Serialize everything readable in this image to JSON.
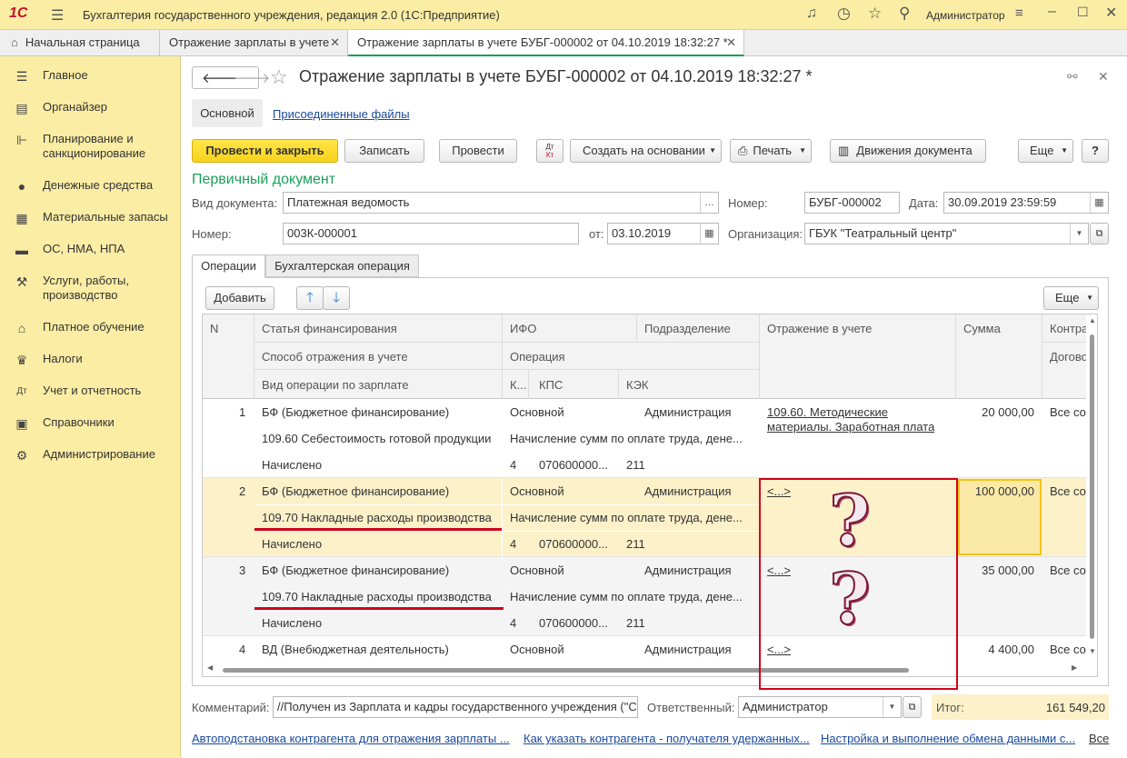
{
  "app": {
    "logo": "1С",
    "title": "Бухгалтерия государственного учреждения, редакция 2.0  (1С:Предприятие)",
    "user": "Администратор"
  },
  "tabs": [
    {
      "label": "Начальная страница"
    },
    {
      "label": "Отражение зарплаты в учете"
    },
    {
      "label": "Отражение зарплаты в учете БУБГ-000002 от 04.10.2019 18:32:27 *"
    }
  ],
  "sidebar": {
    "items": [
      {
        "label": "Главное",
        "icon": "menu-icon"
      },
      {
        "label": "Органайзер",
        "icon": "organizer-icon"
      },
      {
        "label": "Планирование и санкционирование",
        "icon": "planning-icon"
      },
      {
        "label": "Денежные средства",
        "icon": "money-icon"
      },
      {
        "label": "Материальные запасы",
        "icon": "materials-icon"
      },
      {
        "label": "ОС, НМА, НПА",
        "icon": "assets-icon"
      },
      {
        "label": "Услуги, работы, производство",
        "icon": "services-icon"
      },
      {
        "label": "Платное обучение",
        "icon": "education-icon"
      },
      {
        "label": "Налоги",
        "icon": "taxes-icon"
      },
      {
        "label": "Учет и отчетность",
        "icon": "reporting-icon"
      },
      {
        "label": "Справочники",
        "icon": "catalogs-icon"
      },
      {
        "label": "Администрирование",
        "icon": "gear-icon"
      }
    ]
  },
  "document": {
    "title": "Отражение зарплаты в учете БУБГ-000002 от 04.10.2019 18:32:27 *",
    "subtab_main": "Основной",
    "subtab_files": "Присоединенные файлы"
  },
  "toolbar": {
    "post_close": "Провести и закрыть",
    "save": "Записать",
    "post": "Провести",
    "dtkt_top": "Дт",
    "dtkt_bottom": "Кт",
    "create_based": "Создать на основании",
    "print": "Печать",
    "movements": "Движения документа",
    "more": "Еще",
    "help": "?"
  },
  "primary": {
    "section": "Первичный документ",
    "doc_type_label": "Вид документа:",
    "doc_type": "Платежная ведомость",
    "number_label": "Номер:",
    "number": "003К-000001",
    "from_label": "от:",
    "from": "03.10.2019",
    "number2_label": "Номер:",
    "number2": "БУБГ-000002",
    "date_label": "Дата:",
    "date": "30.09.2019 23:59:59",
    "org_label": "Организация:",
    "org": "ГБУК \"Театральный центр\""
  },
  "inner_tabs": {
    "ops": "Операции",
    "acc_op": "Бухгалтерская операция"
  },
  "table_toolbar": {
    "add": "Добавить",
    "more": "Еще"
  },
  "table": {
    "headers": {
      "n": "N",
      "fin": "Статья финансирования",
      "ifo": "ИФО",
      "dept": "Подразделение",
      "reflect": "Отражение в учете",
      "sum": "Сумма",
      "contr": "Контрагент",
      "method": "Способ отражения в учете",
      "operation": "Операция",
      "contract": "Договор",
      "paytype": "Вид операции по зарплате",
      "k": "К...",
      "kps": "КПС",
      "kek": "КЭК"
    },
    "rows": [
      {
        "n": "1",
        "fin": "БФ (Бюджетное финансирование)",
        "ifo": "Основной",
        "dept": "Администрация",
        "reflect1": "109.60. Методические",
        "reflect2": "материалы. Заработная плата",
        "sum": "20 000,00",
        "contr": "Все со",
        "method": "109.60 Себестоимость готовой продукции",
        "operation": "Начисление сумм по оплате труда, дене...",
        "paytype": "Начислено",
        "k": "4",
        "kps": "070600000...",
        "kek": "211"
      },
      {
        "n": "2",
        "fin": "БФ (Бюджетное финансирование)",
        "ifo": "Основной",
        "dept": "Администрация",
        "reflect1": "<...>",
        "reflect2": "",
        "sum": "100 000,00",
        "contr": "Все со",
        "method": "109.70 Накладные расходы производства",
        "operation": "Начисление сумм по оплате труда, дене...",
        "paytype": "Начислено",
        "k": "4",
        "kps": "070600000...",
        "kek": "211"
      },
      {
        "n": "3",
        "fin": "БФ (Бюджетное финансирование)",
        "ifo": "Основной",
        "dept": "Администрация",
        "reflect1": "<...>",
        "reflect2": "",
        "sum": "35 000,00",
        "contr": "Все со",
        "method": "109.70 Накладные расходы производства",
        "operation": "Начисление сумм по оплате труда, дене...",
        "paytype": "Начислено",
        "k": "4",
        "kps": "070600000...",
        "kek": "211"
      },
      {
        "n": "4",
        "fin": "ВД (Внебюджетная деятельность)",
        "ifo": "Основной",
        "dept": "Администрация",
        "reflect1": "<...>",
        "reflect2": "",
        "sum": "4 400,00",
        "contr": "Все со"
      }
    ]
  },
  "annotation": {
    "q1": "?",
    "q2": "?"
  },
  "footer": {
    "comment_label": "Комментарий:",
    "comment": "//Получен из Зарплата и кадры государственного учреждения (\"С",
    "responsible_label": "Ответственный:",
    "responsible": "Администратор",
    "total_label": "Итог:",
    "total": "161 549,20"
  },
  "links": {
    "l1": "Автоподстановка контрагента для отражения зарплаты ...",
    "l2": "Как указать контрагента - получателя удержанных...",
    "l3": "Настройка и выполнение обмена данными с...",
    "all": "Все"
  }
}
